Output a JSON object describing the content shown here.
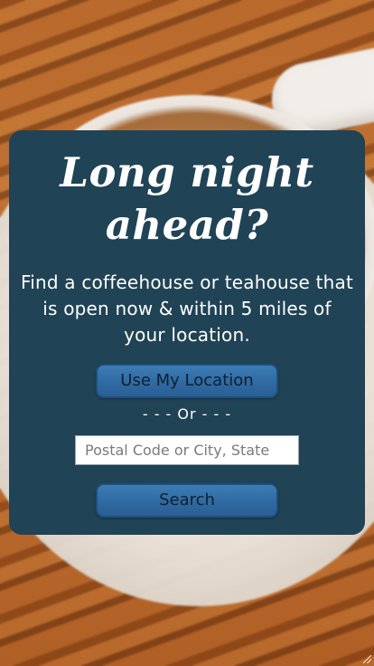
{
  "hero": {
    "headline": "Long night ahead?",
    "description": "Find a coffeehouse or teahouse that is open now & within 5 miles of your location."
  },
  "actions": {
    "use_location_label": "Use My Location",
    "separator_text": "- - - Or - - -",
    "location_input_placeholder": "Postal Code or City, State",
    "location_input_value": "",
    "search_label": "Search"
  },
  "colors": {
    "card_background": "#204356",
    "button_blue": "#3e7cb4",
    "text": "#ffffff"
  },
  "icons": {
    "background": "coffee-cup-photo",
    "corner": "resize-grip-icon"
  }
}
